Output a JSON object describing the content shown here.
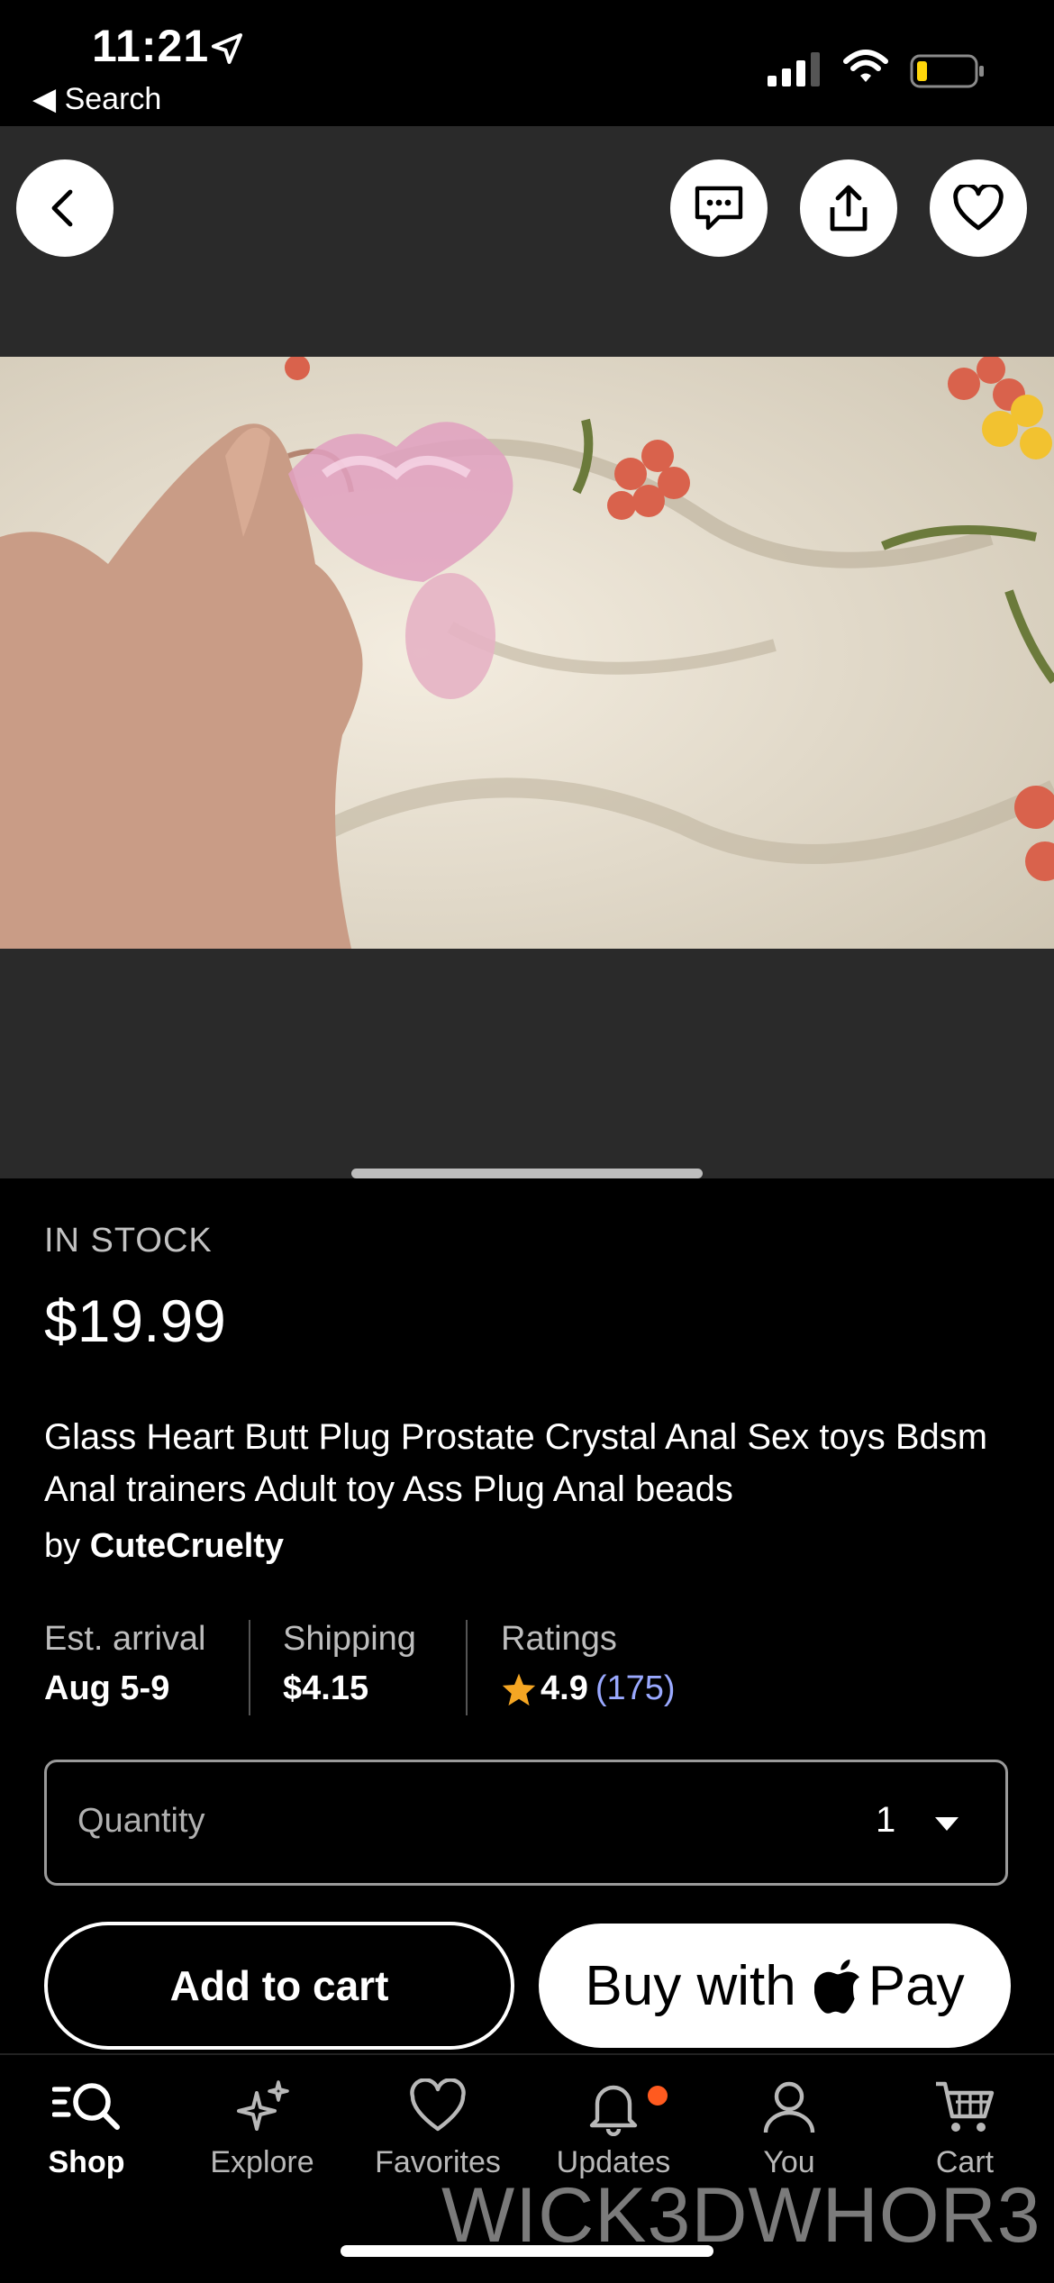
{
  "status_bar": {
    "time": "11:21",
    "back_label": "◀ Search"
  },
  "product": {
    "stock": "IN STOCK",
    "price": "$19.99",
    "title": "Glass Heart Butt Plug Prostate Crystal Anal Sex toys Bdsm Anal trainers Adult toy Ass Plug Anal beads",
    "by_prefix": "by",
    "shop_name": "CuteCruelty"
  },
  "info": {
    "arrival_label": "Est. arrival",
    "arrival_value": "Aug 5-9",
    "shipping_label": "Shipping",
    "shipping_value": "$4.15",
    "ratings_label": "Ratings",
    "rating_value": "4.9",
    "rating_count": "(175)"
  },
  "quantity": {
    "label": "Quantity",
    "value": "1"
  },
  "actions": {
    "add_to_cart": "Add to cart",
    "buy_with": "Buy with",
    "pay": "Pay"
  },
  "tabs": [
    {
      "label": "Shop",
      "icon": "search-icon"
    },
    {
      "label": "Explore",
      "icon": "sparkle-icon"
    },
    {
      "label": "Favorites",
      "icon": "heart-icon"
    },
    {
      "label": "Updates",
      "icon": "bell-icon"
    },
    {
      "label": "You",
      "icon": "person-icon"
    },
    {
      "label": "Cart",
      "icon": "cart-icon"
    }
  ],
  "watermark": "WICK3DWHOR3",
  "colors": {
    "accent_rating": "#9aa9ff",
    "star": "#f5a623",
    "notification_dot": "#ff5a1f"
  }
}
